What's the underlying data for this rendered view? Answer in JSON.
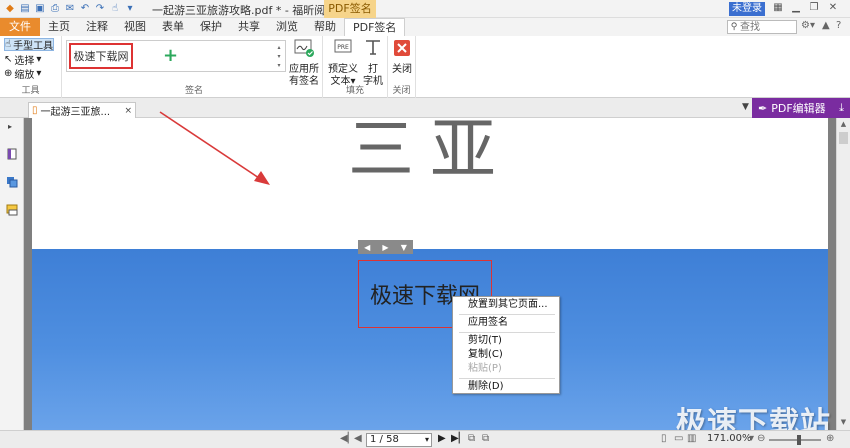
{
  "titlebar": {
    "document_title": "一起游三亚旅游攻略.pdf * - 福昕阅读器",
    "context_tab_title": "PDF签名",
    "login_label": "未登录"
  },
  "menu": {
    "tabs": [
      "文件",
      "主页",
      "注释",
      "视图",
      "表单",
      "保护",
      "共享",
      "浏览",
      "帮助",
      "PDF签名"
    ],
    "search_placeholder": "查找"
  },
  "ribbon": {
    "tools": {
      "hand_tool": "手型工具",
      "select": "选择",
      "zoom": "缩放",
      "group_label": "工具"
    },
    "signatures": {
      "saved_signature_text": "极速下载网",
      "add_symbol": "+",
      "group_label": "签名"
    },
    "apply_all": {
      "line1": "应用所",
      "line2": "有签名"
    },
    "fill": {
      "predefined_line1": "预定义",
      "predefined_line2": "文本",
      "typewriter_line1": "打",
      "typewriter_line2": "字机",
      "group_label": "填充"
    },
    "close": {
      "label": "关闭",
      "group_label": "关闭"
    }
  },
  "doc_tab": {
    "label": "一起游三亚旅...",
    "close_symbol": "×"
  },
  "pdf_editor_button": "PDF编辑器",
  "page_content": {
    "heading_chars": "三亚",
    "placed_signature_text": "极速下载网"
  },
  "context_menu": {
    "items": [
      {
        "label": "放置到其它页面...",
        "disabled": false
      },
      {
        "label": "应用签名",
        "disabled": false
      },
      {
        "label": "剪切(T)",
        "disabled": false
      },
      {
        "label": "复制(C)",
        "disabled": false
      },
      {
        "label": "粘贴(P)",
        "disabled": true
      },
      {
        "label": "删除(D)",
        "disabled": false
      }
    ]
  },
  "statusbar": {
    "page_indicator": "1 / 58",
    "zoom_level": "171.00%"
  },
  "watermark": "极速下载站",
  "colors": {
    "accent_orange": "#e98b2d",
    "context_tab": "#f6d48a",
    "editor_purple": "#7a2ca0",
    "signature_border": "#dd3333",
    "page_blue": "#3e7fd6"
  }
}
